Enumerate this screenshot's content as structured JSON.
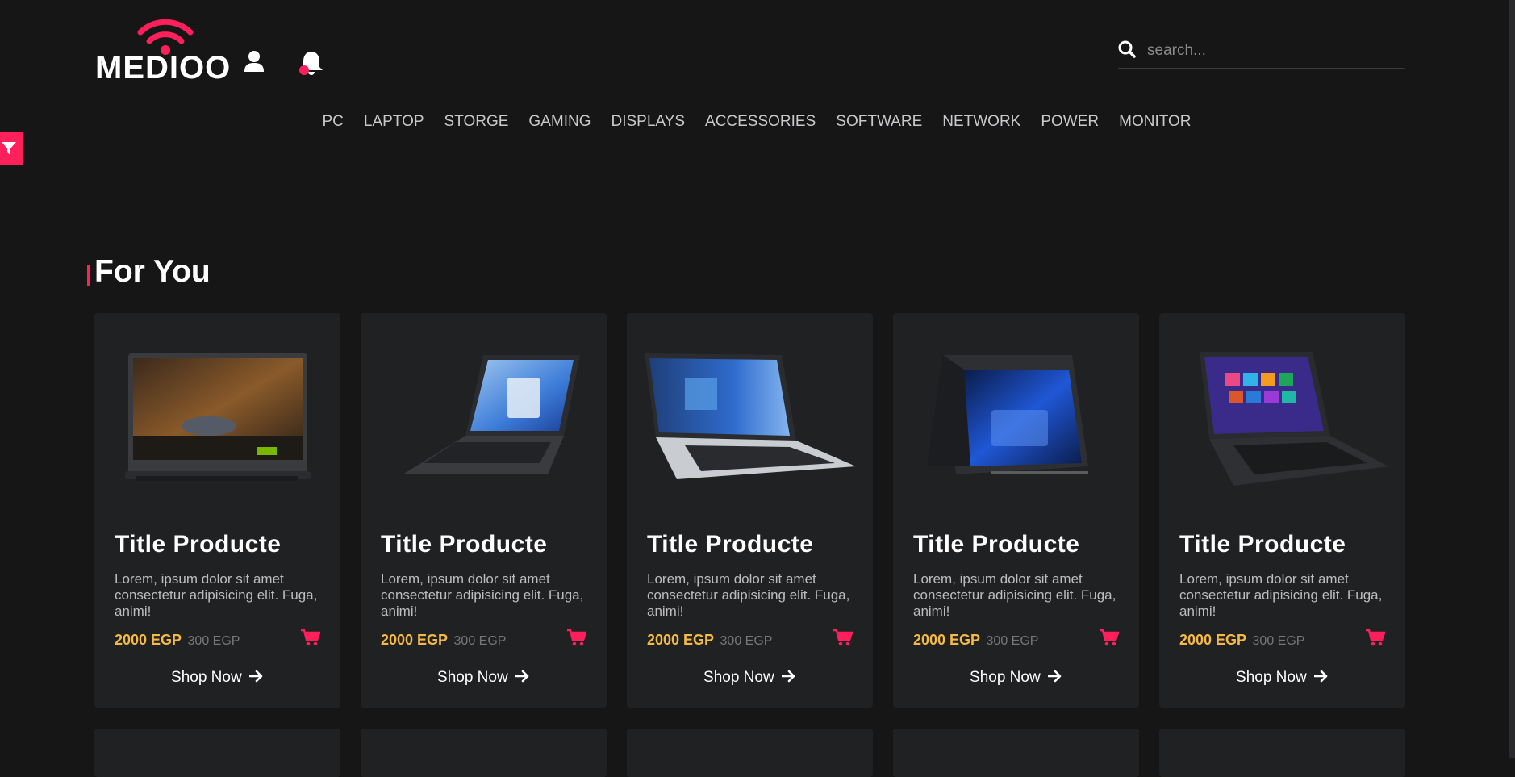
{
  "header": {
    "logo_text": "MEDIOO",
    "search_placeholder": "search..."
  },
  "nav": {
    "items": [
      "PC",
      "LAPTOP",
      "STORGE",
      "GAMING",
      "DISPLAYS",
      "ACCESSORIES",
      "SOFTWARE",
      "NETWORK",
      "POWER",
      "MONITOR"
    ]
  },
  "section": {
    "title": "For You"
  },
  "products": [
    {
      "title": "Title Producte",
      "description": "Lorem, ipsum dolor sit amet consectetur adipisicing elit. Fuga, animi!",
      "price": "2000 EGP",
      "old_price": "300 EGP",
      "cta": "Shop Now"
    },
    {
      "title": "Title Producte",
      "description": "Lorem, ipsum dolor sit amet consectetur adipisicing elit. Fuga, animi!",
      "price": "2000 EGP",
      "old_price": "300 EGP",
      "cta": "Shop Now"
    },
    {
      "title": "Title Producte",
      "description": "Lorem, ipsum dolor sit amet consectetur adipisicing elit. Fuga, animi!",
      "price": "2000 EGP",
      "old_price": "300 EGP",
      "cta": "Shop Now"
    },
    {
      "title": "Title Producte",
      "description": "Lorem, ipsum dolor sit amet consectetur adipisicing elit. Fuga, animi!",
      "price": "2000 EGP",
      "old_price": "300 EGP",
      "cta": "Shop Now"
    },
    {
      "title": "Title Producte",
      "description": "Lorem, ipsum dolor sit amet consectetur adipisicing elit. Fuga, animi!",
      "price": "2000 EGP",
      "old_price": "300 EGP",
      "cta": "Shop Now"
    }
  ],
  "colors": {
    "accent": "#ff1f5a",
    "price": "#f5b945",
    "background": "#161617",
    "card": "#202123"
  },
  "icons": {
    "logo": "wifi-signal-icon",
    "user": "user-icon",
    "notification": "bell-icon",
    "search": "search-icon",
    "filter": "filter-icon",
    "cart": "cart-icon",
    "arrow": "arrow-right-icon"
  }
}
